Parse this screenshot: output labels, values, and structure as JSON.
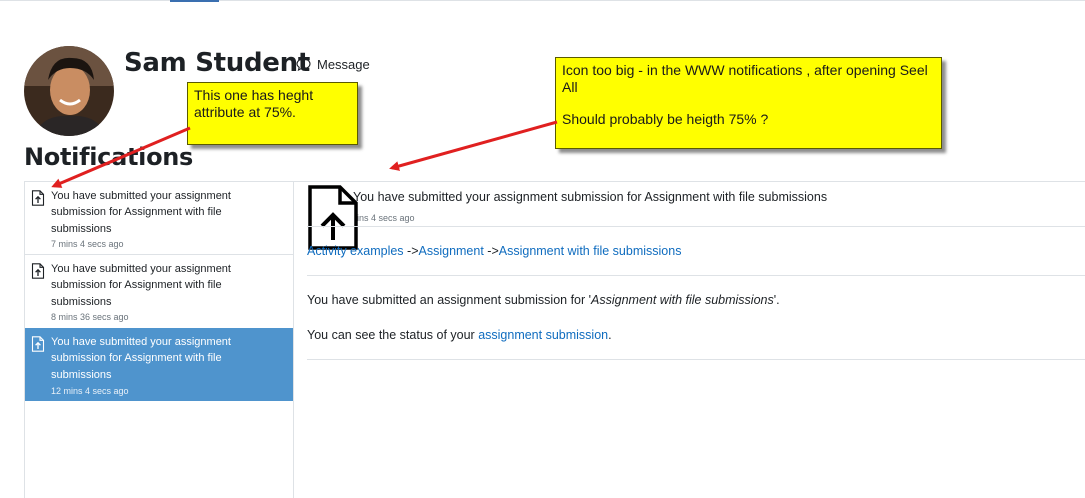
{
  "profile": {
    "name": "Sam Student",
    "message_label": "Message"
  },
  "page": {
    "title": "Notifications"
  },
  "notifications": [
    {
      "text": "You have submitted your assignment submission for Assignment with file submissions",
      "time": "7 mins 4 secs ago",
      "selected": false
    },
    {
      "text": "You have submitted your assignment submission for Assignment with file submissions",
      "time": "8 mins 36 secs ago",
      "selected": false
    },
    {
      "text": "You have submitted your assignment submission for Assignment with file submissions",
      "time": "12 mins 4 secs ago",
      "selected": true
    }
  ],
  "detail": {
    "subject": "You have submitted your assignment submission for Assignment with file submissions",
    "time": "12 mins 4 secs ago",
    "breadcrumb": {
      "part1": "Activity examples",
      "sep1": " ->",
      "part2": "Assignment",
      "sep2": " ->",
      "part3": "Assignment with file submissions"
    },
    "body1_prefix": "You have submitted an assignment submission for '",
    "body1_em": "Assignment with file submissions",
    "body1_suffix": "'.",
    "body2_prefix": "You can see the status of your ",
    "body2_link": "assignment submission",
    "body2_suffix": "."
  },
  "annotations": {
    "note1": "This one has heght attribute at 75%.",
    "note2_line1": "Icon too big - in the WWW notifications , after opening Seel All",
    "note2_line2": "Should probably be heigth 75% ?"
  },
  "colors": {
    "selected_bg": "#4f94cd",
    "link": "#0f6cbf",
    "note_bg": "#ffff00",
    "arrow": "#e02020"
  },
  "icons": {
    "notification_icon": "file-upload-icon",
    "message_icon": "speech-bubble-icon"
  }
}
